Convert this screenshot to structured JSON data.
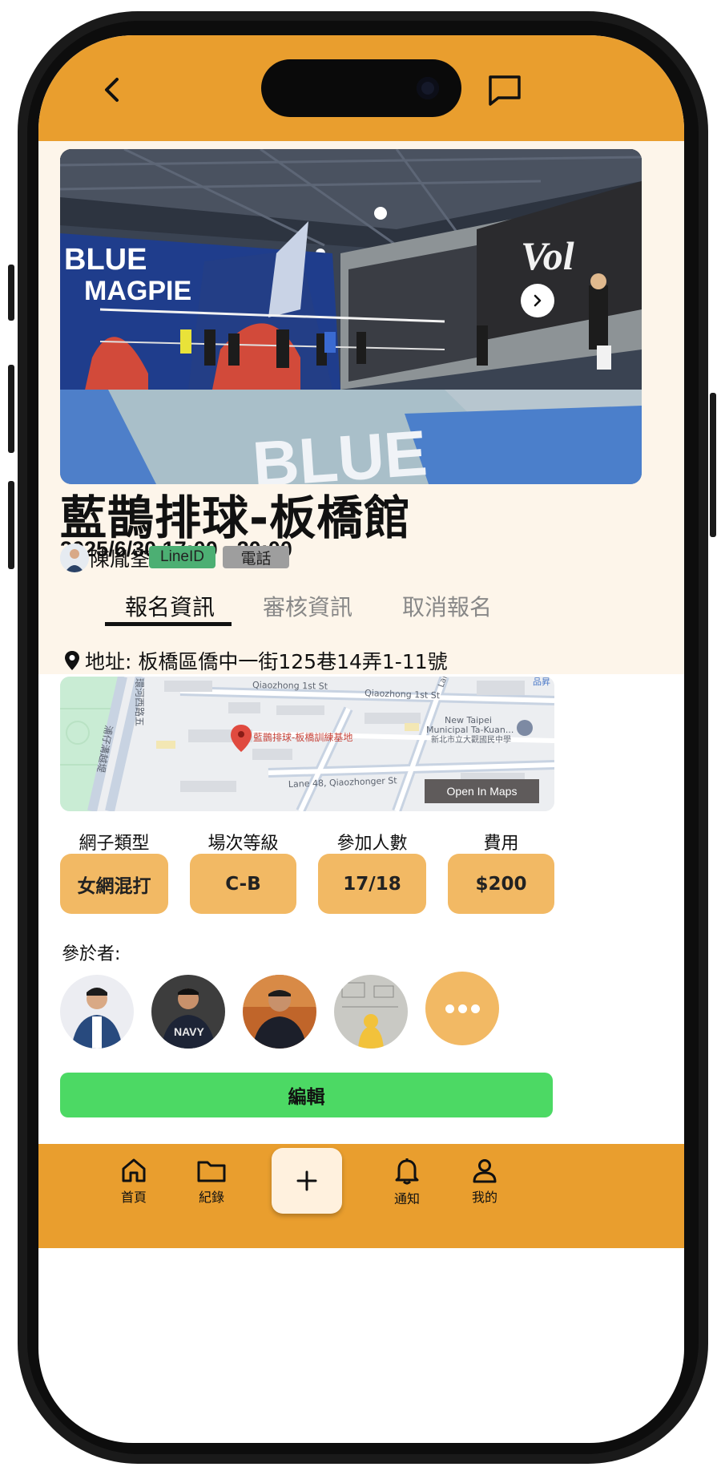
{
  "header": {
    "back_icon": "chevron-left-icon",
    "message_icon": "chat-bubble-icon"
  },
  "event": {
    "photo_icon": "volleyball-court-photo",
    "title": "藍鵲排球-板橋館",
    "datetime": "2025/6/30 17:00 - 20:00",
    "organizer_name": "陳胤筌",
    "line_chip": "LineID",
    "phone_chip": "電話"
  },
  "tabs": [
    {
      "label": "報名資訊",
      "active": true
    },
    {
      "label": "審核資訊",
      "active": false
    },
    {
      "label": "取消報名",
      "active": false
    }
  ],
  "location": {
    "address": "地址: 板橋區僑中一街125巷14弄1-11號",
    "map": {
      "marker_label": "藍鵲排球-板橋訓練基地",
      "street_1": "Qiaozhong 1st St",
      "street_2": "Qiaozhong 1st St",
      "street_3": "Lane 48, Qiaozhonger St",
      "street_4": "Lane",
      "school_1": "New Taipei",
      "school_2": "Municipal Ta-Kuan...",
      "school_3": "新北市立大觀國民中學",
      "road_1": "環河西路五",
      "road_2": "浦仔溝越堤",
      "corner": "品昇",
      "open_label": "Open In Maps"
    }
  },
  "stats": [
    {
      "label": "網子類型",
      "value": "女網混打"
    },
    {
      "label": "場次等級",
      "value": "C-B"
    },
    {
      "label": "參加人數",
      "value": "17/18"
    },
    {
      "label": "費用",
      "value": "$200"
    }
  ],
  "participants": {
    "label": "參於者:",
    "more_icon": "more-dots-icon"
  },
  "edit_label": "編輯",
  "bottom_nav": [
    {
      "label": "首頁",
      "icon": "home-icon"
    },
    {
      "label": "紀錄",
      "icon": "folder-icon"
    },
    {
      "label": "通知",
      "icon": "bell-icon"
    },
    {
      "label": "我的",
      "icon": "user-icon"
    }
  ],
  "fab_icon": "plus-icon",
  "colors": {
    "accent": "#e99e2e",
    "hero_bg": "#fdf5ea",
    "stat_box": "#f2b964",
    "edit_button": "#4cd964",
    "line_chip": "#4caf73",
    "phone_chip": "#9e9e9e"
  }
}
